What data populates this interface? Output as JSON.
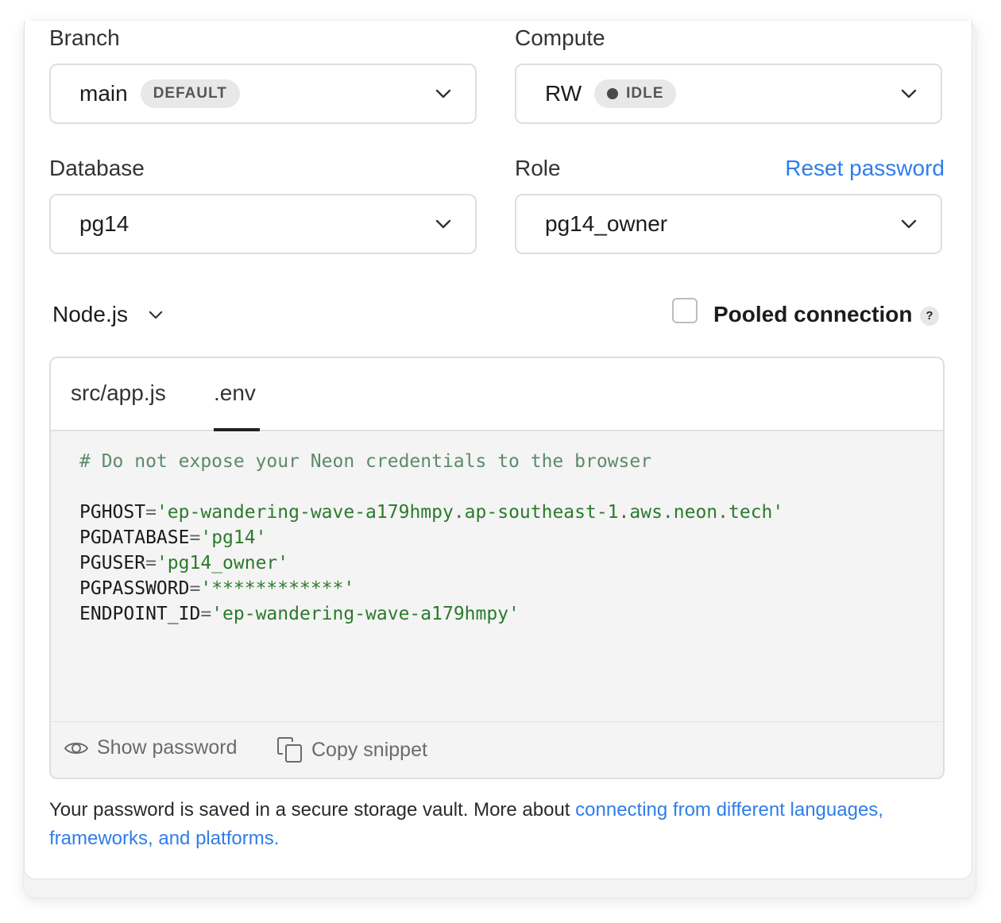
{
  "branch": {
    "label": "Branch",
    "value": "main",
    "badge": "DEFAULT"
  },
  "compute": {
    "label": "Compute",
    "value": "RW",
    "status": "IDLE"
  },
  "database": {
    "label": "Database",
    "value": "pg14"
  },
  "role": {
    "label": "Role",
    "reset_link": "Reset password",
    "value": "pg14_owner"
  },
  "language": {
    "value": "Node.js"
  },
  "pooled": {
    "label": "Pooled connection",
    "help": "?",
    "checked": false
  },
  "tabs": [
    {
      "label": "src/app.js",
      "active": false
    },
    {
      "label": ".env",
      "active": true
    }
  ],
  "code": {
    "comment": "# Do not expose your Neon credentials to the browser",
    "lines": [
      {
        "key": "PGHOST",
        "value": "'ep-wandering-wave-a179hmpy.ap-southeast-1.aws.neon.tech'"
      },
      {
        "key": "PGDATABASE",
        "value": "'pg14'"
      },
      {
        "key": "PGUSER",
        "value": "'pg14_owner'"
      },
      {
        "key": "PGPASSWORD",
        "value": "'************'"
      },
      {
        "key": "ENDPOINT_ID",
        "value": "'ep-wandering-wave-a179hmpy'"
      }
    ]
  },
  "footer": {
    "show_password": "Show password",
    "copy_snippet": "Copy snippet"
  },
  "note": {
    "text": "Your password is saved in a secure storage vault. More about ",
    "link": "connecting from different languages, frameworks, and platforms."
  },
  "colors": {
    "link": "#2f7ee8",
    "code_string": "#2b7a2b",
    "code_comment": "#5c8a6a"
  }
}
